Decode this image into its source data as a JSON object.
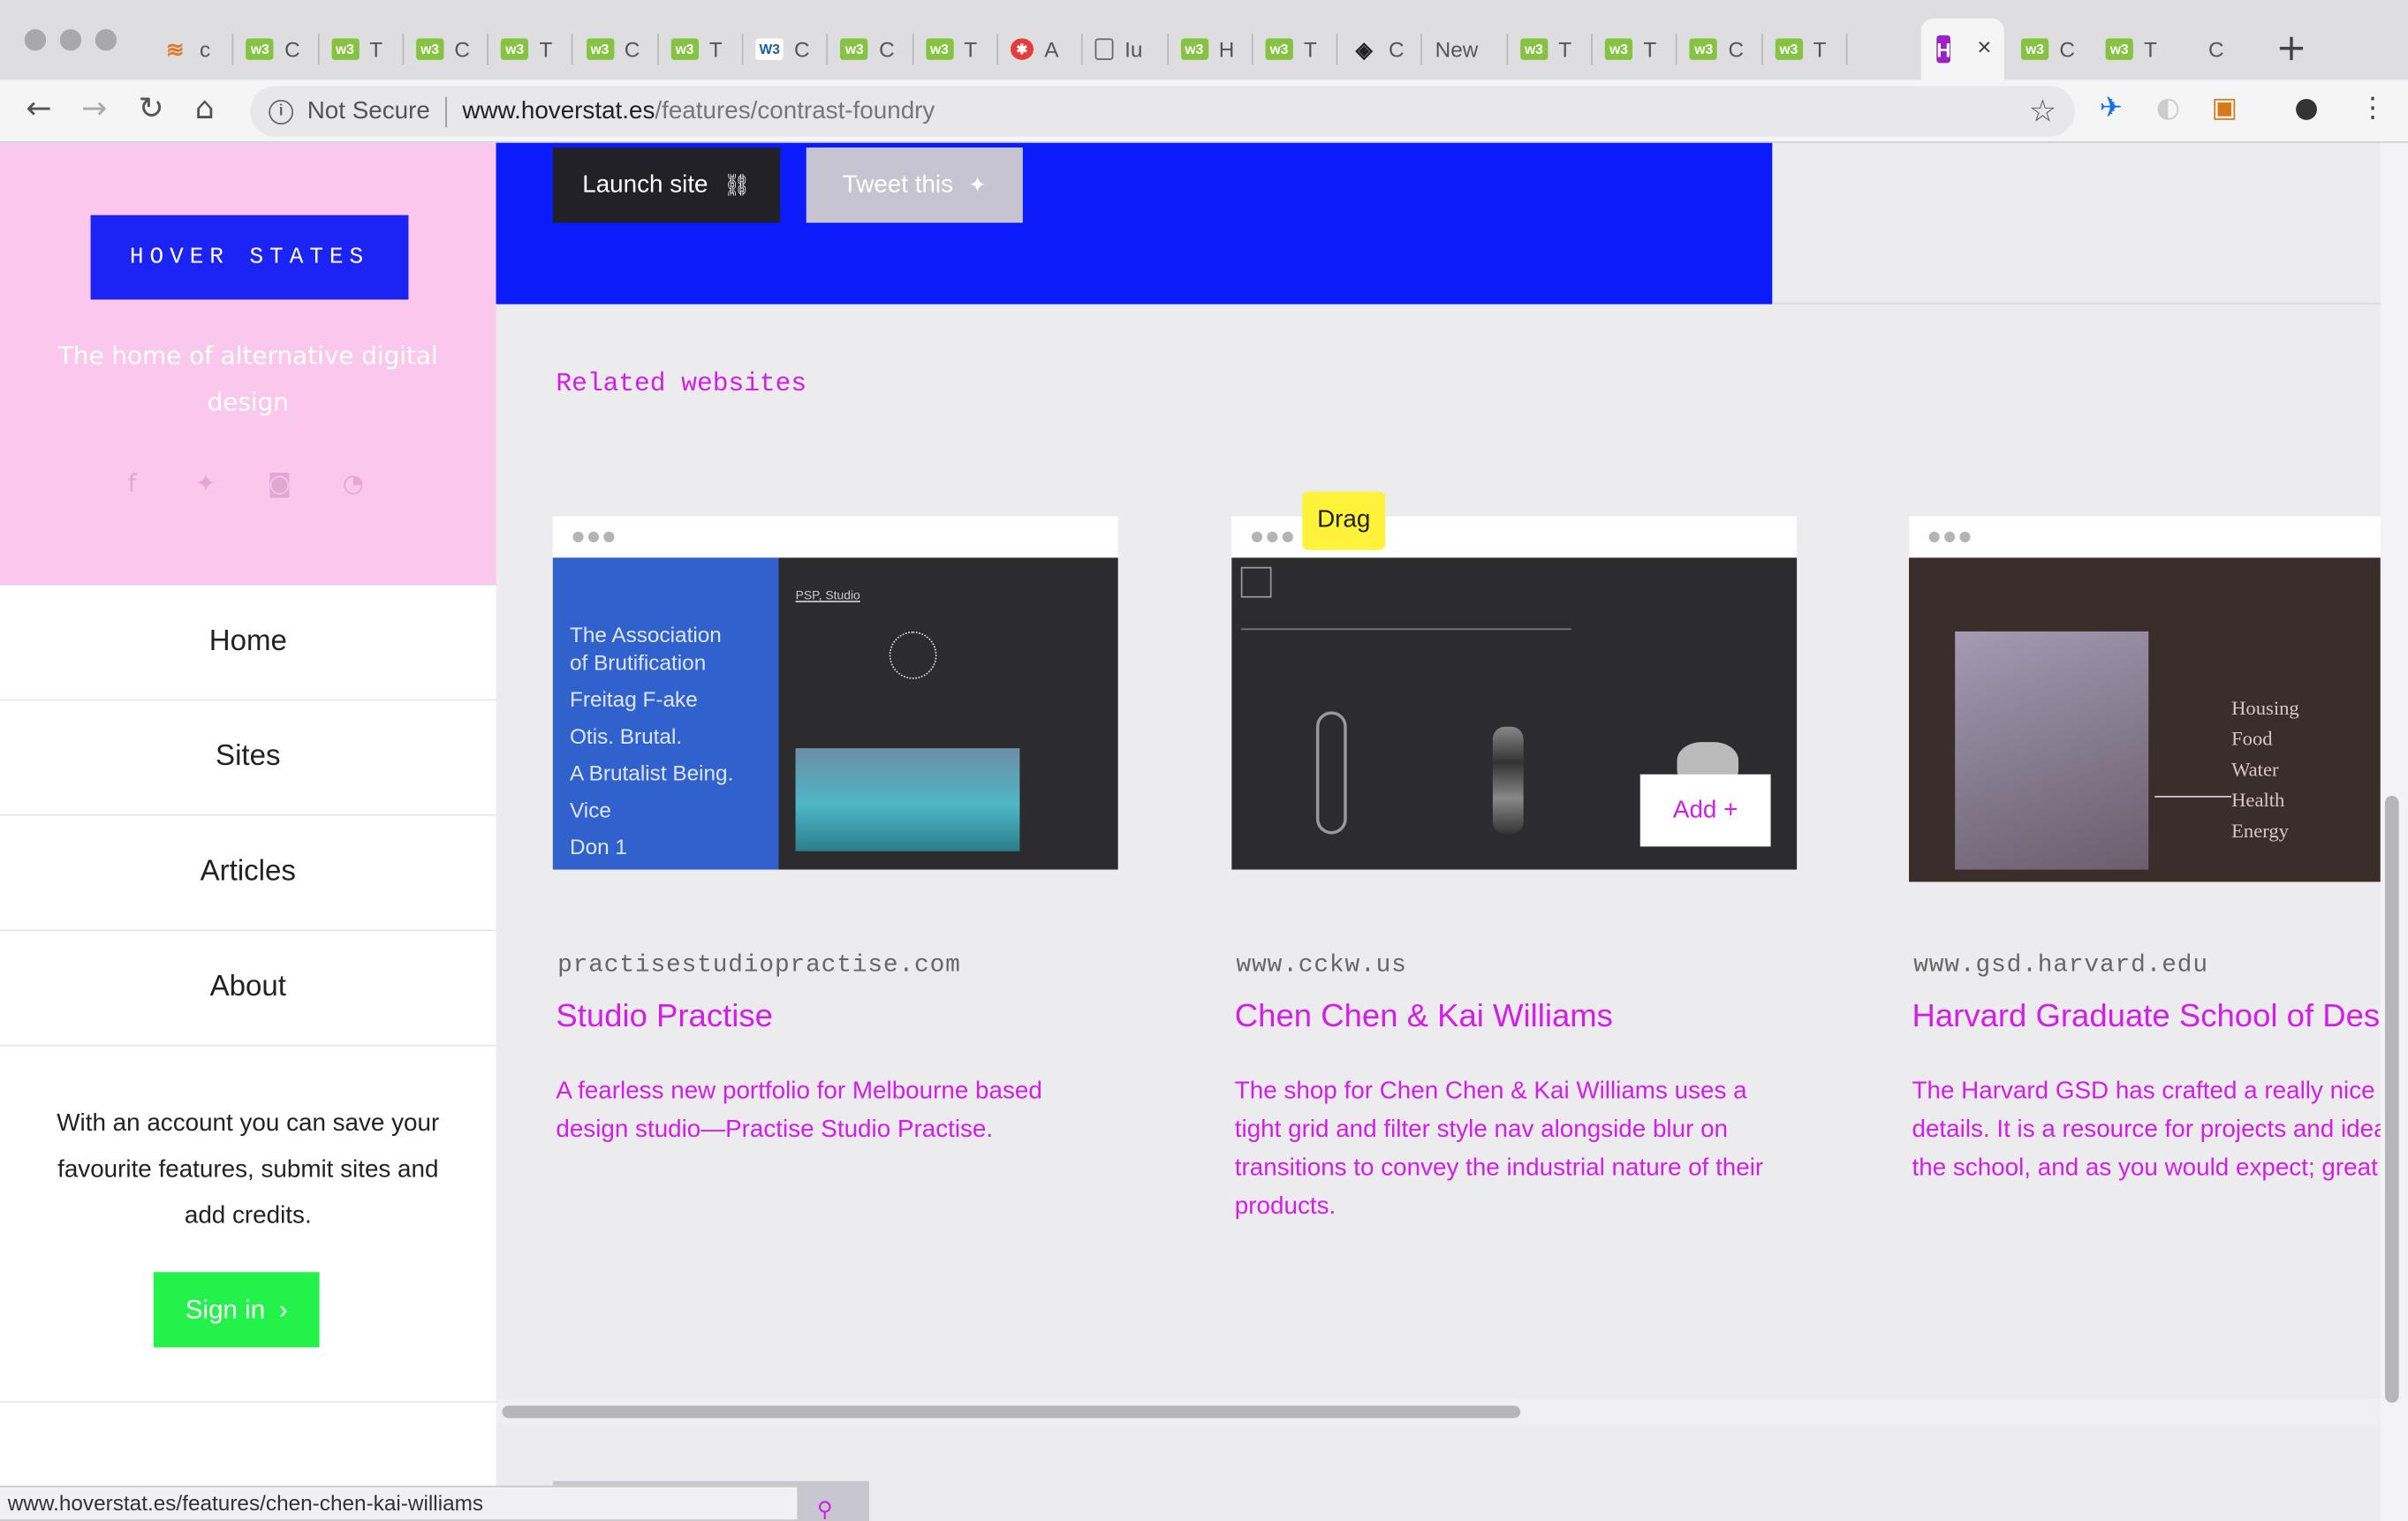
{
  "browser": {
    "tabs": [
      {
        "label": "c",
        "icon": "stack-icon"
      },
      {
        "label": "C",
        "icon": "w3-icon"
      },
      {
        "label": "T",
        "icon": "w3-icon"
      },
      {
        "label": "C",
        "icon": "w3-icon"
      },
      {
        "label": "T",
        "icon": "w3-icon"
      },
      {
        "label": "C",
        "icon": "w3-icon"
      },
      {
        "label": "T",
        "icon": "w3-icon"
      },
      {
        "label": "C",
        "icon": "w3c-icon"
      },
      {
        "label": "C",
        "icon": "w3-icon"
      },
      {
        "label": "T",
        "icon": "w3-icon"
      },
      {
        "label": "A",
        "icon": "asterisk-icon"
      },
      {
        "label": "Iu",
        "icon": "page-icon"
      },
      {
        "label": "H",
        "icon": "w3-icon"
      },
      {
        "label": "T",
        "icon": "w3-icon"
      },
      {
        "label": "C",
        "icon": "codepen-icon"
      },
      {
        "label": "New",
        "icon": ""
      },
      {
        "label": "T",
        "icon": "w3-icon"
      },
      {
        "label": "T",
        "icon": "w3-icon"
      },
      {
        "label": "C",
        "icon": "w3-icon"
      },
      {
        "label": "T",
        "icon": "w3-icon"
      }
    ],
    "active_tab": {
      "icon_letter": "H",
      "close": "×"
    },
    "after_tabs": [
      {
        "label": "C",
        "icon": "w3-icon"
      },
      {
        "label": "T",
        "icon": "w3-icon"
      },
      {
        "label": "C",
        "icon": ""
      }
    ],
    "new_tab": "+",
    "not_secure": "Not Secure",
    "url_host": "www.hoverstat.es",
    "url_path": "/features/contrast-foundry",
    "status_url": "www.hoverstat.es/features/chen-chen-kai-williams"
  },
  "sidebar": {
    "logo": "HOVER STATES",
    "tagline": "The home of alternative digital design",
    "socials": [
      "facebook-icon",
      "twitter-icon",
      "instagram-icon",
      "rss-icon"
    ],
    "nav": [
      "Home",
      "Sites",
      "Articles",
      "About"
    ],
    "message": "With an account you can save your favourite features, submit sites and add credits.",
    "signin": "Sign in"
  },
  "hero": {
    "launch": "Launch site",
    "tweet": "Tweet this"
  },
  "related": {
    "heading": "Related websites",
    "cards": [
      {
        "domain": "practisestudiopractise.com",
        "title": "Studio Practise",
        "desc": "A fearless new portfolio for Melbourne based design studio—Practise Studio Practise.",
        "shot_lines": [
          "The Association",
          "of Brutification",
          "Freitag F-ake",
          "Otis. Brutal.",
          "A Brutalist Being.",
          "Vice",
          "Don 1"
        ],
        "shot_label": "PSP, Studio"
      },
      {
        "domain": "www.cckw.us",
        "title": "Chen Chen & Kai Williams",
        "desc": "The shop for Chen Chen & Kai Williams uses a tight grid and filter style nav alongside blur on transitions to convey the industrial nature of their products.",
        "drag": "Drag",
        "add": "Add  +"
      },
      {
        "domain": "www.gsd.harvard.edu",
        "title": "Harvard Graduate School of Design",
        "desc": "The Harvard GSD has crafted a really nice site with great details. It is a resource for projects and ideas coming out of the school, and as you would expect; great content.",
        "shot_list": [
          "Housing",
          "Food",
          "Water",
          "Health",
          "Energy"
        ]
      }
    ]
  },
  "colors": {
    "accent": "#d21ee8",
    "hero_blue": "#0b1bf9",
    "sidebar_pink": "#f9c8ec",
    "signin_green": "#23f24a",
    "drag_yellow": "#fff23a"
  }
}
